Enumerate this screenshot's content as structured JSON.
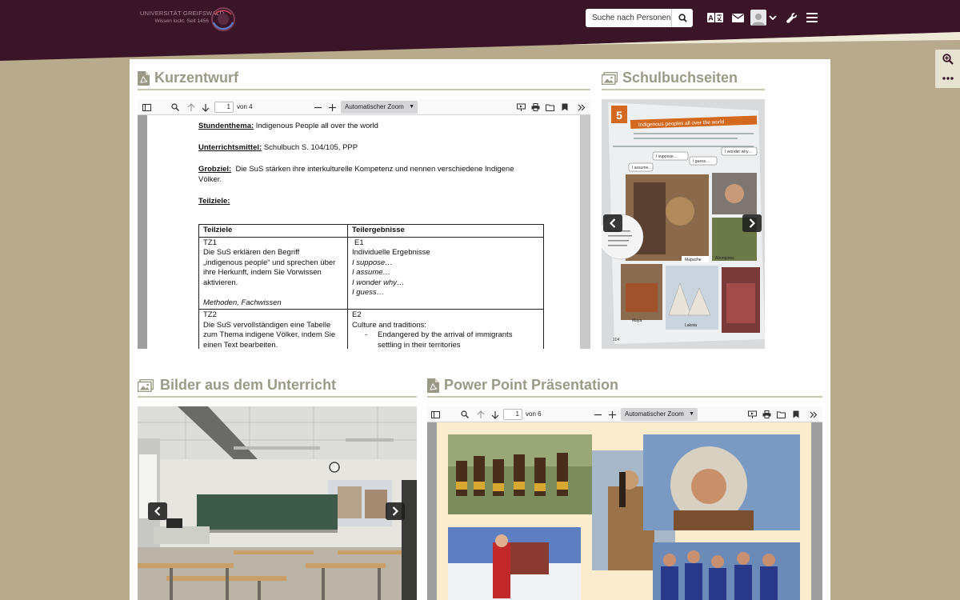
{
  "header": {
    "logo_name": "UNIVERSITÄT GREIFSWALD",
    "logo_tagline": "Wissen lockt. Seit 1456",
    "search": {
      "placeholder": "Suche nach Personen"
    },
    "icons": [
      "search-icon",
      "translate-icon",
      "mail-icon",
      "user-avatar-icon",
      "chevron-down-icon",
      "wrench-icon",
      "menu-icon"
    ]
  },
  "side_tools": [
    "zoom-in-icon",
    "more-icon"
  ],
  "colors": {
    "header_bg": "#3a1427",
    "page_bg": "#b8aa8c",
    "section_title": "#9c9a86",
    "accent": "#c9c6b2"
  },
  "sections": {
    "kurzentwurf": {
      "title": "Kurzentwurf",
      "icon": "pdf-file-icon",
      "viewer": {
        "page": "1",
        "page_of": "von 4",
        "zoom": "Automatischer Zoom"
      },
      "doc": {
        "stundenthema_label": "Stundenthema:",
        "stundenthema": "Indigenous People all over the world",
        "unterrichtsmittel_label": "Unterrichtsmittel:",
        "unterrichtsmittel": "Schulbuch S. 104/105, PPP",
        "grobziel_label": "Grobziel:",
        "grobziel_1": "Die SuS stärken ihre interkulturelle Kompetenz und nennen verschiedene Indigene",
        "grobziel_2": "Völker.",
        "teilziele_label": "Teilziele:",
        "table": {
          "col1": "Teilziele",
          "col2": "Teilergebnisse",
          "tz1": {
            "id": "TZ1",
            "l1": "Die SuS erklären den Begriff",
            "l2": "„indigenous people“ und sprechen über",
            "l3": "ihre Herkunft, indem Sie Vorwissen",
            "l4": "aktivieren.",
            "methods": "Methoden, Fachwissen"
          },
          "e1": {
            "id": "E1",
            "title": "Individuelle Ergebnisse",
            "i1": "I suppose…",
            "i2": "I assume…",
            "i3": "I wonder why…",
            "i4": "I guess…"
          },
          "tz2": {
            "id": "TZ2",
            "l1": "Die SuS vervollständigen eine Tabelle",
            "l2": "zum Thema indigene Völker, indem Sie",
            "l3": "einen Text bearbeiten."
          },
          "e2": {
            "id": "E2",
            "title": "Culture and traditions:",
            "b1": "Endangered by the arrival of immigrants",
            "b2": "settling in their territories"
          }
        }
      }
    },
    "schulbuch": {
      "title": "Schulbuchseiten",
      "icon": "images-icon",
      "book": {
        "unit": "5",
        "heading": "Indigenous peoples all over the world",
        "t1": "I suppose…",
        "t2": "I wonder why…",
        "t3": "I assume…",
        "t4": "I guess…",
        "cap1": "Mapuche",
        "cap2": "Aborigines",
        "cap3": "Lakota",
        "cap4": "Maya",
        "page": "104"
      }
    },
    "bilder": {
      "title": "Bilder aus dem Unterricht",
      "icon": "images-icon"
    },
    "ppp": {
      "title": "Power Point Präsentation",
      "icon": "pdf-file-icon",
      "viewer": {
        "page": "1",
        "page_of": "von 6",
        "zoom": "Automatischer Zoom"
      }
    }
  }
}
